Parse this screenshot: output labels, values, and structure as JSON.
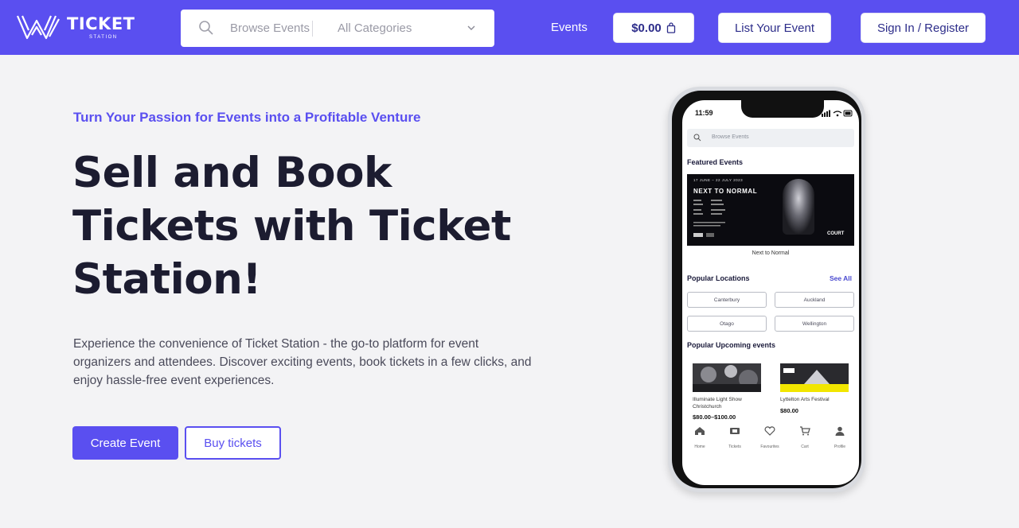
{
  "header": {
    "logo_text": "TICKET",
    "logo_sub": "STATION",
    "search": {
      "placeholder": "Browse Events"
    },
    "category_select": {
      "selected": "All Categories"
    },
    "nav_events": "Events",
    "cart_label": "$0.00",
    "list_event_label": "List Your Event",
    "sign_in_label": "Sign In / Register"
  },
  "hero": {
    "tagline": "Turn Your Passion for Events into a Profitable Venture",
    "title": "Sell and Book Tickets with Ticket Station!",
    "description": "Experience the convenience of Ticket Station - the go-to platform for event organizers and attendees. Discover exciting events, book tickets in a few clicks, and enjoy hassle-free event experiences.",
    "create_event_label": "Create Event",
    "buy_tickets_label": "Buy tickets"
  },
  "phone": {
    "time": "11:59",
    "search_placeholder": "Browse Events",
    "featured_heading": "Featured Events",
    "banner": {
      "date": "17 JUNE – 22 JULY 2023",
      "title": "NEXT TO NORMAL",
      "court": "COURT"
    },
    "banner_caption": "Next to Normal",
    "popular_locations_heading": "Popular Locations",
    "see_all": "See All",
    "locations": [
      "Canterbury",
      "Auckland",
      "Otago",
      "Wellington"
    ],
    "upcoming_heading": "Popular Upcoming events",
    "events": [
      {
        "title": "Illuminate Light Show Christchurch",
        "price": "$80.00–$100.00"
      },
      {
        "title": "Lyttelton Arts Festival",
        "price": "$80.00"
      }
    ],
    "tabs": [
      "Home",
      "Tickets",
      "Favourites",
      "Cart",
      "Profile"
    ]
  },
  "colors": {
    "brand": "#5a4ff0",
    "background": "#f3f3f5",
    "heading": "#1c1c30"
  }
}
